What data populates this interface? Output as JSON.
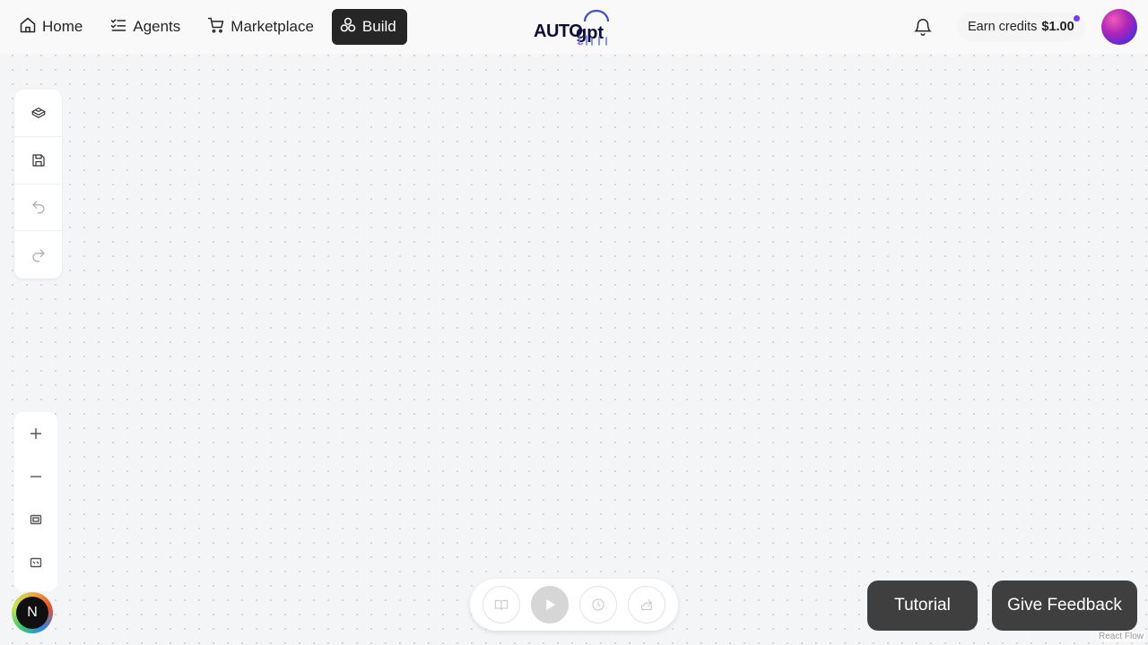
{
  "nav": {
    "items": [
      {
        "label": "Home",
        "icon": "home-icon"
      },
      {
        "label": "Agents",
        "icon": "list-checks-icon"
      },
      {
        "label": "Marketplace",
        "icon": "cart-icon"
      },
      {
        "label": "Build",
        "icon": "blocks-icon",
        "active": true
      }
    ]
  },
  "logo": {
    "text": "AUTO",
    "icon": "autogpt-logo"
  },
  "header": {
    "notification_icon": "bell-icon",
    "credits_label": "Earn credits",
    "credits_value": "$1.00"
  },
  "toolbar": {
    "items": [
      {
        "icon": "blocks-icon",
        "enabled": true
      },
      {
        "icon": "save-icon",
        "enabled": true
      },
      {
        "icon": "undo-icon",
        "enabled": false
      },
      {
        "icon": "redo-icon",
        "enabled": false
      }
    ]
  },
  "zoom": {
    "items": [
      "zoom-in-icon",
      "zoom-out-icon",
      "fit-view-icon",
      "lock-icon"
    ]
  },
  "user": {
    "initial": "N"
  },
  "runbar": {
    "items": [
      "book-icon",
      "play-icon",
      "clock-icon",
      "share-icon"
    ]
  },
  "buttons": {
    "tutorial": "Tutorial",
    "feedback": "Give Feedback"
  },
  "attribution": "React Flow",
  "colors": {
    "active_nav": "#262626",
    "credits_dot": "#7c3aed",
    "button_bg": "#3f3f3f"
  }
}
